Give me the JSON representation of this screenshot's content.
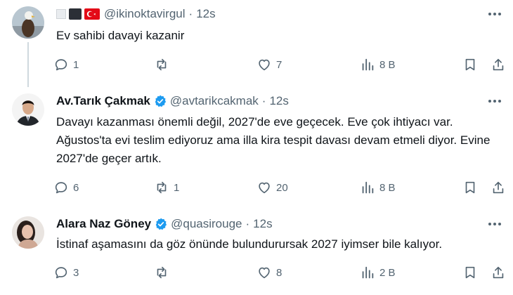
{
  "tweets": [
    {
      "author_name": "",
      "handle": "@ikinoktavirgul",
      "separator": "·",
      "time": "12s",
      "verified": false,
      "text": "Ev sahibi davayi kazanir",
      "replies": "1",
      "retweets": "",
      "likes": "7",
      "views": "8 B"
    },
    {
      "author_name": "Av.Tarık Çakmak",
      "handle": "@avtarikcakmak",
      "separator": "·",
      "time": "12s",
      "verified": true,
      "text": "Davayı kazanması önemli değil, 2027'de eve geçecek. Eve çok ihtiyacı var. Ağustos'ta evi teslim ediyoruz ama illa kira tespit davası devam etmeli diyor. Evine 2027'de geçer artık.",
      "replies": "6",
      "retweets": "1",
      "likes": "20",
      "views": "8 B"
    },
    {
      "author_name": "Alara Naz Göney",
      "handle": "@quasirouge",
      "separator": "·",
      "time": "12s",
      "verified": true,
      "text": "İstinaf aşamasını da göz önünde bulundurursak 2027 iyimser bile kalıyor.",
      "replies": "3",
      "retweets": "",
      "likes": "8",
      "views": "2 B"
    }
  ],
  "colors": {
    "accent": "#1d9bf0",
    "muted": "#536471",
    "text": "#0f1419",
    "thread": "#cfd9de",
    "flag_red": "#e30a17"
  },
  "icons": [
    "reply-icon",
    "retweet-icon",
    "like-icon",
    "views-icon",
    "bookmark-icon",
    "share-icon",
    "more-icon",
    "verified-icon"
  ]
}
